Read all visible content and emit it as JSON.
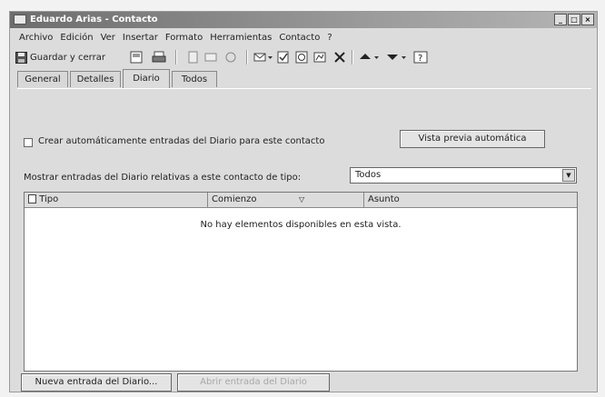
{
  "window": {
    "title": "Eduardo Arias - Contacto"
  },
  "menu": [
    "Archivo",
    "Edición",
    "Ver",
    "Insertar",
    "Formato",
    "Herramientas",
    "Contacto",
    "?"
  ],
  "toolbar": {
    "save_close_label": "Guardar y cerrar"
  },
  "tabs": [
    {
      "label": "General",
      "active": false
    },
    {
      "label": "Detalles",
      "active": false
    },
    {
      "label": "Diario",
      "active": true
    },
    {
      "label": "Todos",
      "active": false
    }
  ],
  "journal": {
    "auto_record_label": "Crear automáticamente entradas del Diario para este contacto",
    "auto_record_checked": false,
    "preview_button": "Vista previa automática",
    "filter_label": "Mostrar entradas del Diario relativas a este contacto de tipo:",
    "filter_value": "Todos",
    "columns": [
      "Tipo",
      "Comienzo",
      "Asunto"
    ],
    "empty_message": "No hay elementos disponibles en esta vista.",
    "new_entry_button": "Nueva entrada del Diario...",
    "open_entry_button": "Abrir entrada del Diario"
  }
}
